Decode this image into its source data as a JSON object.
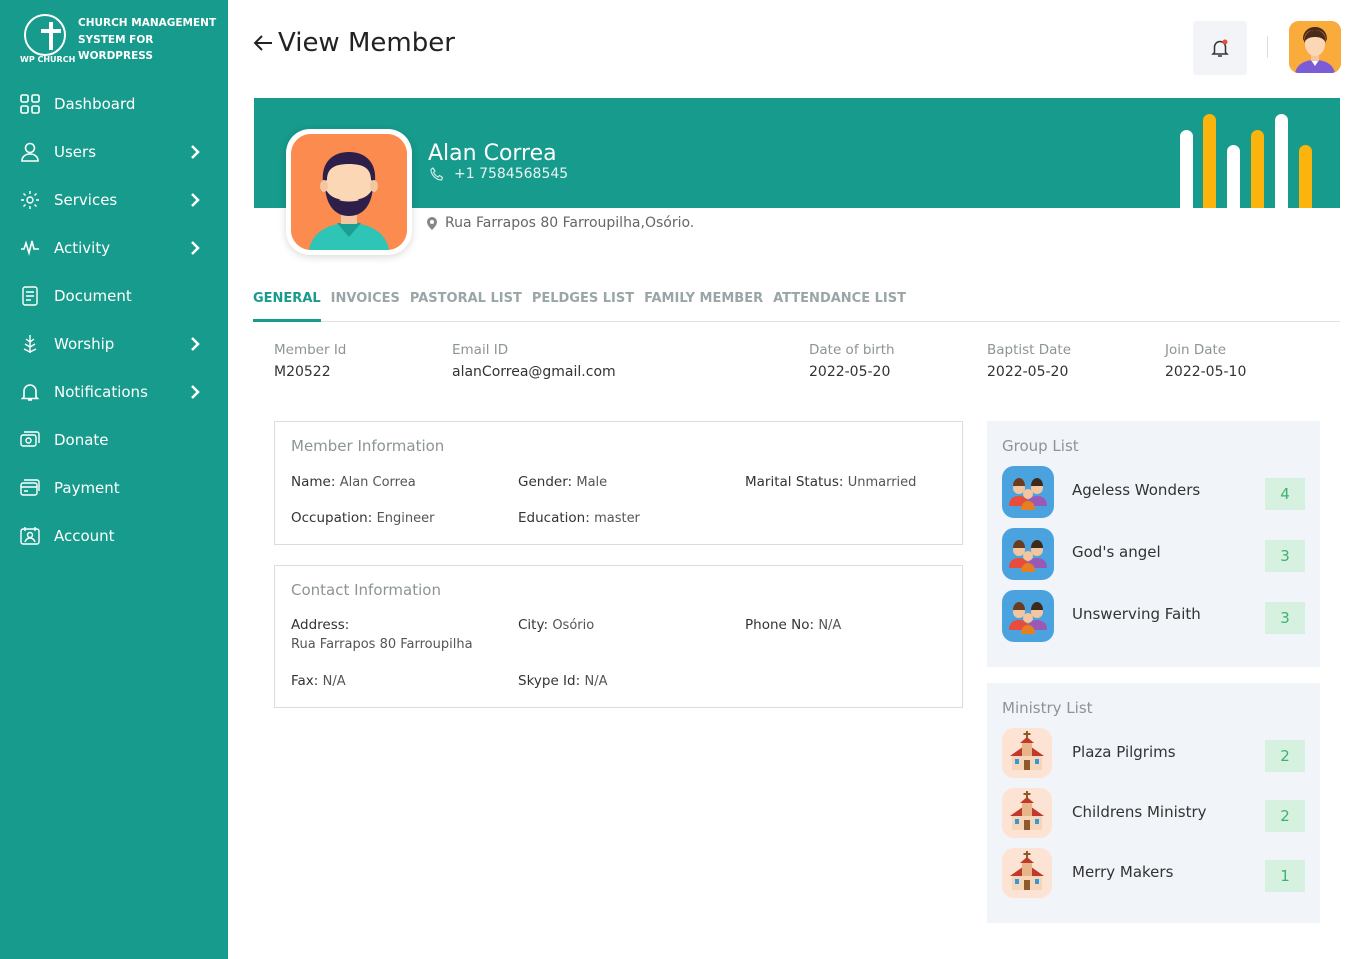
{
  "brand": {
    "logo_caption": "WP CHURCH",
    "title_lines": [
      "CHURCH MANAGEMENT",
      "SYSTEM FOR",
      "WORDPRESS"
    ]
  },
  "sidebar": {
    "items": [
      {
        "label": "Dashboard",
        "icon": "dashboard-icon",
        "has_submenu": false
      },
      {
        "label": "Users",
        "icon": "user-icon",
        "has_submenu": true
      },
      {
        "label": "Services",
        "icon": "services-icon",
        "has_submenu": true
      },
      {
        "label": "Activity",
        "icon": "activity-icon",
        "has_submenu": true
      },
      {
        "label": "Document",
        "icon": "document-icon",
        "has_submenu": false
      },
      {
        "label": "Worship",
        "icon": "worship-icon",
        "has_submenu": true
      },
      {
        "label": "Notifications",
        "icon": "bell-icon",
        "has_submenu": true
      },
      {
        "label": "Donate",
        "icon": "donate-icon",
        "has_submenu": false
      },
      {
        "label": "Payment",
        "icon": "payment-icon",
        "has_submenu": false
      },
      {
        "label": "Account",
        "icon": "account-icon",
        "has_submenu": false
      }
    ]
  },
  "header": {
    "title": "View Member"
  },
  "profile": {
    "name": "Alan Correa",
    "phone": "+1 7584568545",
    "address": "Rua Farrapos 80 Farroupilha,Osório."
  },
  "tabs": [
    {
      "label": "GENERAL",
      "active": true
    },
    {
      "label": "INVOICES",
      "active": false
    },
    {
      "label": "PASTORAL LIST",
      "active": false
    },
    {
      "label": "PELDGES LIST",
      "active": false
    },
    {
      "label": "FAMILY MEMBER",
      "active": false
    },
    {
      "label": "ATTENDANCE LIST",
      "active": false
    }
  ],
  "summary": {
    "member_id": {
      "label": "Member Id",
      "value": "M20522"
    },
    "email": {
      "label": "Email ID",
      "value": "alanCorrea@gmail.com"
    },
    "dob": {
      "label": "Date of birth",
      "value": "2022-05-20"
    },
    "baptist": {
      "label": "Baptist Date",
      "value": "2022-05-20"
    },
    "join": {
      "label": "Join Date",
      "value": "2022-05-10"
    }
  },
  "member_info": {
    "title": "Member Information",
    "name_label": "Name:",
    "name": "Alan Correa",
    "gender_label": "Gender:",
    "gender": "Male",
    "marital_label": "Marital Status:",
    "marital": "Unmarried",
    "occupation_label": "Occupation:",
    "occupation": "Engineer",
    "education_label": "Education:",
    "education": "master"
  },
  "contact_info": {
    "title": "Contact Information",
    "address_label": "Address:",
    "address": "Rua Farrapos 80 Farroupilha",
    "city_label": "City:",
    "city": "Osório",
    "phone_label": "Phone No:",
    "phone": "N/A",
    "fax_label": "Fax:",
    "fax": "N/A",
    "skype_label": "Skype Id:",
    "skype": "N/A"
  },
  "group_list": {
    "title": "Group List",
    "items": [
      {
        "name": "Ageless Wonders",
        "count": "4"
      },
      {
        "name": "God's angel",
        "count": "3"
      },
      {
        "name": "Unswerving Faith",
        "count": "3"
      }
    ]
  },
  "ministry_list": {
    "title": "Ministry List",
    "items": [
      {
        "name": "Plaza Pilgrims",
        "count": "2"
      },
      {
        "name": "Childrens Ministry",
        "count": "2"
      },
      {
        "name": "Merry Makers",
        "count": "1"
      }
    ]
  },
  "colors": {
    "primary": "#179b8c",
    "accent_yellow": "#fbb40b",
    "count_bg": "#d7f1e0",
    "count_text": "#3cb371",
    "panel_bg": "#f1f4f8"
  }
}
